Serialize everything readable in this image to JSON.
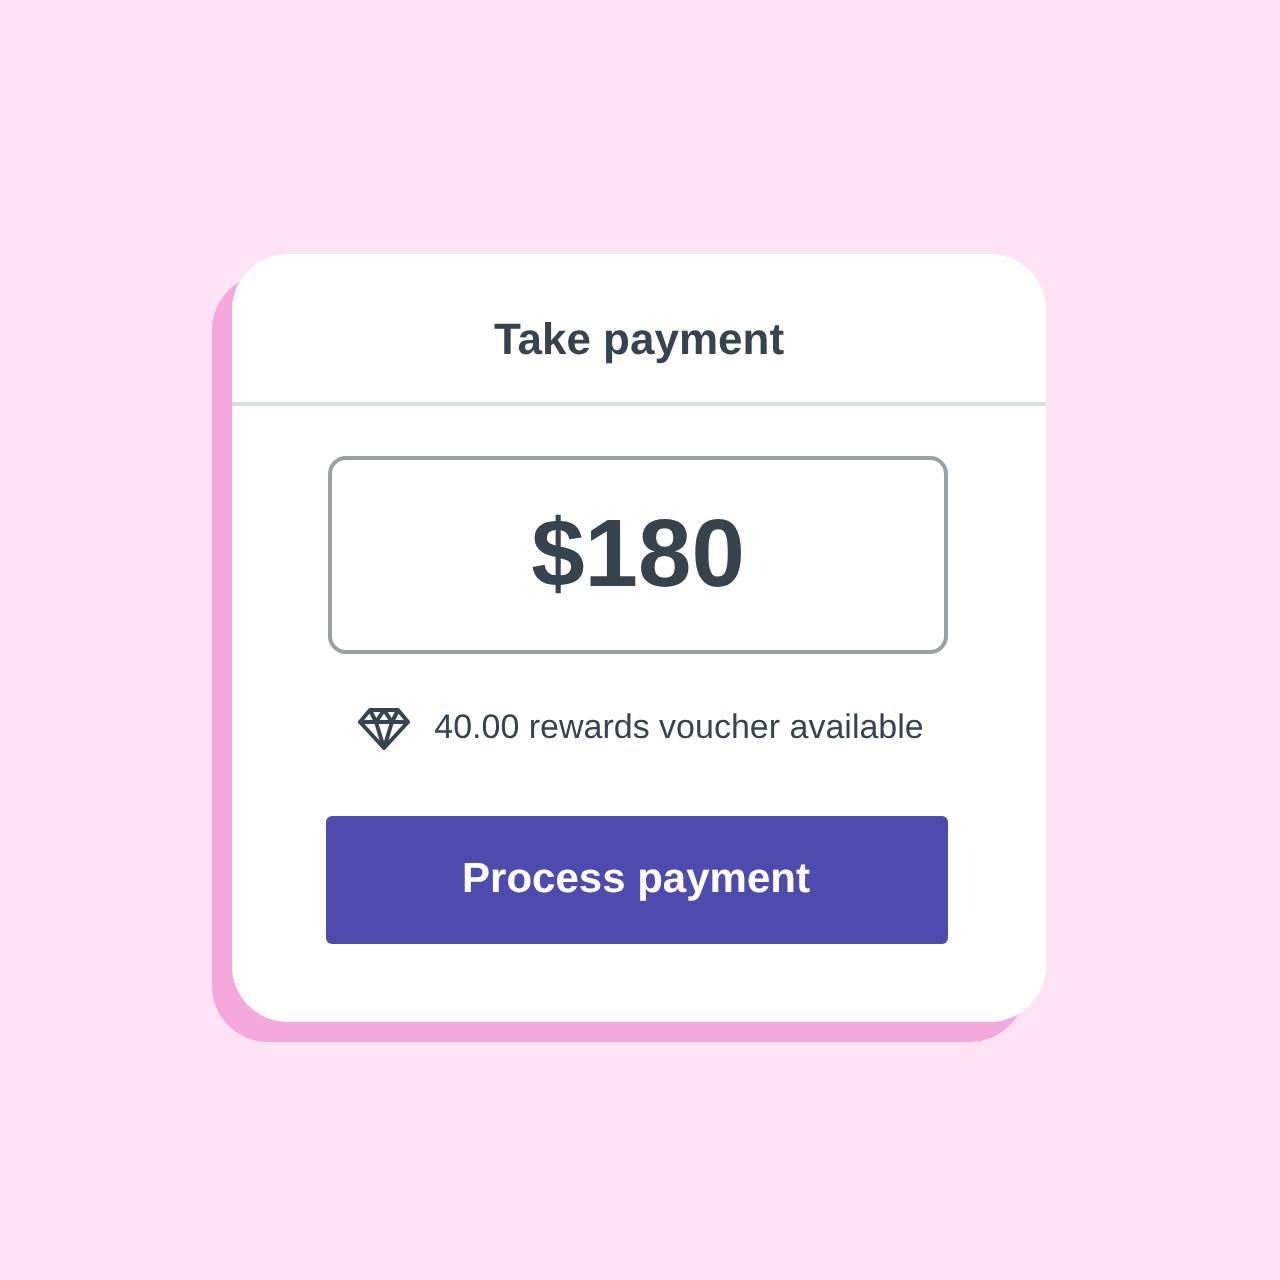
{
  "card": {
    "title": "Take payment",
    "amount_field": {
      "value": "$180"
    },
    "rewards_note": "40.00 rewards voucher available",
    "button": {
      "label": "Process payment"
    }
  }
}
